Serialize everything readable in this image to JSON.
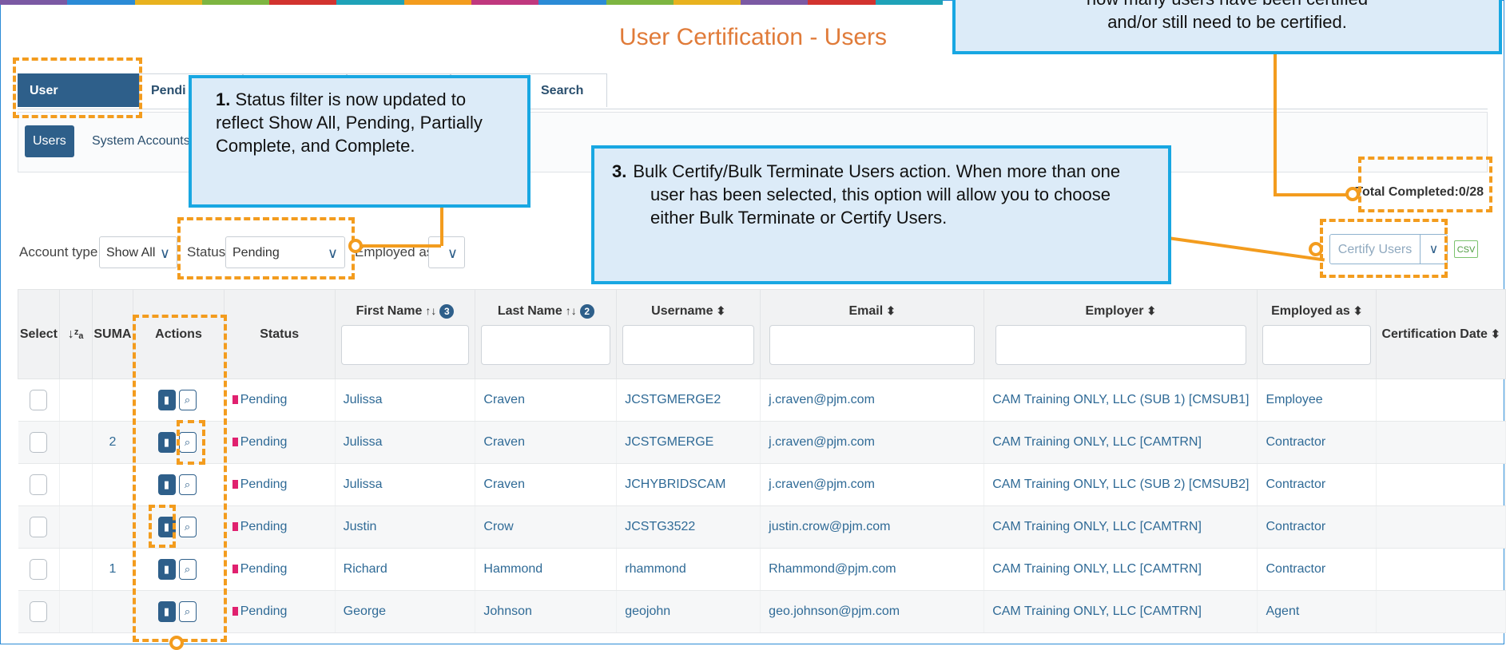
{
  "page": {
    "title": "User Certification - Users"
  },
  "topbar_colors": [
    "#7b59a3",
    "#2b8bd6",
    "#e8b21f",
    "#7db541",
    "#d2332f",
    "#1fa2b8",
    "#f39c1e",
    "#c0387e",
    "#2b8bd6",
    "#7db541",
    "#e8b21f",
    "#7b59a3",
    "#d2332f",
    "#1fa2b8"
  ],
  "tabs": [
    {
      "label": "User Certification"
    },
    {
      "label": "Pendi"
    },
    {
      "label": ""
    },
    {
      "label": ""
    },
    {
      "label": ""
    },
    {
      "label": "Search"
    }
  ],
  "subtabs": [
    {
      "label": "Users"
    },
    {
      "label": "System Accounts"
    }
  ],
  "filters": {
    "account_type_label": "Account type",
    "account_type_value": "Show All",
    "status_label": "Status",
    "status_value": "Pending",
    "employed_as_label": "Employed as",
    "employed_as_value": ""
  },
  "total_completed": "Total Completed:0/28",
  "certify": {
    "label": "Certify Users",
    "csv_label": "CSV"
  },
  "table": {
    "headers": {
      "select": "Select",
      "sort_icon": "↓ᶻₐ",
      "suma": "SUMA",
      "actions": "Actions",
      "status": "Status",
      "first_name": "First Name",
      "first_badge": "3",
      "last_name": "Last Name",
      "last_badge": "2",
      "username": "Username",
      "email": "Email",
      "employer": "Employer",
      "employed_as": "Employed as",
      "cert_date": "Certification Date"
    },
    "rows": [
      {
        "suma": "",
        "status": "Pending",
        "first": "Julissa",
        "last": "Craven",
        "username": "JCSTGMERGE2",
        "email": "j.craven@pjm.com",
        "employer": "CAM Training ONLY, LLC (SUB 1) [CMSUB1]",
        "employed_as": "Employee",
        "cert_date": ""
      },
      {
        "suma": "2",
        "status": "Pending",
        "first": "Julissa",
        "last": "Craven",
        "username": "JCSTGMERGE",
        "email": "j.craven@pjm.com",
        "employer": "CAM Training ONLY, LLC [CAMTRN]",
        "employed_as": "Contractor",
        "cert_date": ""
      },
      {
        "suma": "",
        "status": "Pending",
        "first": "Julissa",
        "last": "Craven",
        "username": "JCHYBRIDSCAM",
        "email": "j.craven@pjm.com",
        "employer": "CAM Training ONLY, LLC (SUB 2) [CMSUB2]",
        "employed_as": "Contractor",
        "cert_date": ""
      },
      {
        "suma": "",
        "status": "Pending",
        "first": "Justin",
        "last": "Crow",
        "username": "JCSTG3522",
        "email": "justin.crow@pjm.com",
        "employer": "CAM Training ONLY, LLC [CAMTRN]",
        "employed_as": "Contractor",
        "cert_date": ""
      },
      {
        "suma": "1",
        "status": "Pending",
        "first": "Richard",
        "last": "Hammond",
        "username": "rhammond",
        "email": "Rhammond@pjm.com",
        "employer": "CAM Training ONLY, LLC [CAMTRN]",
        "employed_as": "Contractor",
        "cert_date": ""
      },
      {
        "suma": "",
        "status": "Pending",
        "first": "George",
        "last": "Johnson",
        "username": "geojohn",
        "email": "geo.johnson@pjm.com",
        "employer": "CAM Training ONLY, LLC [CAMTRN]",
        "employed_as": "Agent",
        "cert_date": ""
      }
    ]
  },
  "callouts": {
    "c1_num": "1.",
    "c1_text": "Status filter is now updated to reflect Show All, Pending, Partially Complete, and Complete.",
    "c2_text_line1": "how many users have been certified",
    "c2_text_line2": "and/or still need to be certified.",
    "c3_num": "3.",
    "c3_text": "Bulk Certify/Bulk Terminate Users action. When more than one user has been selected, this option will allow you to choose either Bulk Terminate or Certify Users."
  }
}
